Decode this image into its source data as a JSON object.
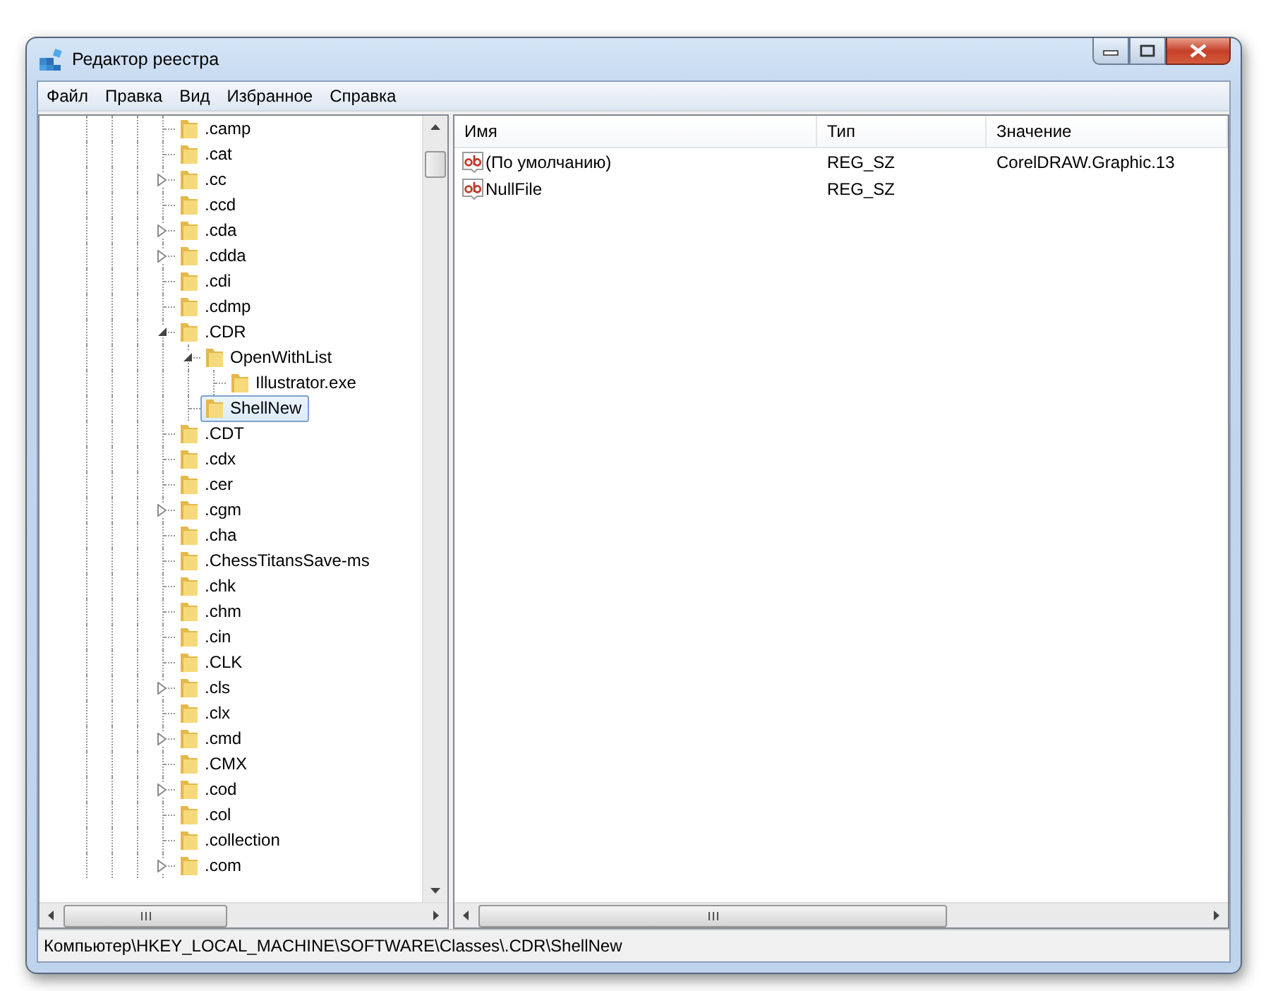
{
  "window": {
    "title": "Редактор реестра"
  },
  "menu": [
    "Файл",
    "Правка",
    "Вид",
    "Избранное",
    "Справка"
  ],
  "tree": {
    "items": [
      {
        "label": ".camp",
        "selected": false
      },
      {
        "label": ".cat",
        "selected": false
      },
      {
        "label": ".cc",
        "expanded": false,
        "selected": false
      },
      {
        "label": ".ccd",
        "selected": false
      },
      {
        "label": ".cda",
        "expanded": false,
        "selected": false
      },
      {
        "label": ".cdda",
        "expanded": false,
        "selected": false
      },
      {
        "label": ".cdi",
        "selected": false
      },
      {
        "label": ".cdmp",
        "selected": false
      },
      {
        "label": ".CDR",
        "expanded": true,
        "selected": false,
        "children": [
          {
            "label": "OpenWithList",
            "expanded": true,
            "selected": false,
            "children": [
              {
                "label": "Illustrator.exe",
                "selected": false
              }
            ]
          },
          {
            "label": "ShellNew",
            "selected": true
          }
        ]
      },
      {
        "label": ".CDT",
        "selected": false
      },
      {
        "label": ".cdx",
        "selected": false
      },
      {
        "label": ".cer",
        "selected": false
      },
      {
        "label": ".cgm",
        "expanded": false,
        "selected": false
      },
      {
        "label": ".cha",
        "selected": false
      },
      {
        "label": ".ChessTitansSave-ms",
        "selected": false
      },
      {
        "label": ".chk",
        "selected": false
      },
      {
        "label": ".chm",
        "selected": false
      },
      {
        "label": ".cin",
        "selected": false
      },
      {
        "label": ".CLK",
        "selected": false
      },
      {
        "label": ".cls",
        "expanded": false,
        "selected": false
      },
      {
        "label": ".clx",
        "selected": false
      },
      {
        "label": ".cmd",
        "expanded": false,
        "selected": false
      },
      {
        "label": ".CMX",
        "selected": false
      },
      {
        "label": ".cod",
        "expanded": false,
        "selected": false
      },
      {
        "label": ".col",
        "selected": false
      },
      {
        "label": ".collection",
        "selected": false
      },
      {
        "label": ".com",
        "expanded": false,
        "selected": false
      }
    ]
  },
  "list": {
    "columns": [
      "Имя",
      "Тип",
      "Значение"
    ],
    "rows": [
      {
        "name": "(По умолчанию)",
        "type": "REG_SZ",
        "data": "CorelDRAW.Graphic.13"
      },
      {
        "name": "NullFile",
        "type": "REG_SZ"
      }
    ]
  },
  "status_bar": "Компьютер\\HKEY_LOCAL_MACHINE\\SOFTWARE\\Classes\\.CDR\\ShellNew"
}
